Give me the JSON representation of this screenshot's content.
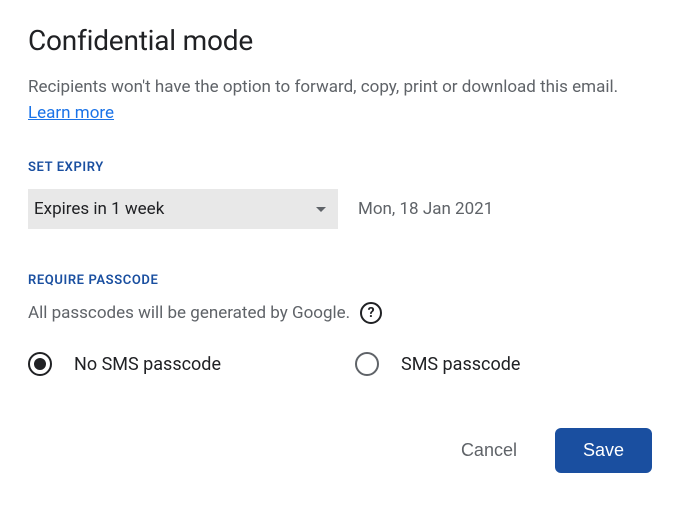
{
  "title": "Confidential mode",
  "description": "Recipients won't have the option to forward, copy, print or download this email. ",
  "learn_more": "Learn more",
  "expiry": {
    "label": "SET EXPIRY",
    "selected": "Expires in 1 week",
    "date": "Mon, 18 Jan 2021"
  },
  "passcode": {
    "label": "REQUIRE PASSCODE",
    "description": "All passcodes will be generated by Google.",
    "help": "?",
    "options": {
      "no_sms": "No SMS passcode",
      "sms": "SMS passcode"
    },
    "selected": "no_sms"
  },
  "buttons": {
    "cancel": "Cancel",
    "save": "Save"
  }
}
